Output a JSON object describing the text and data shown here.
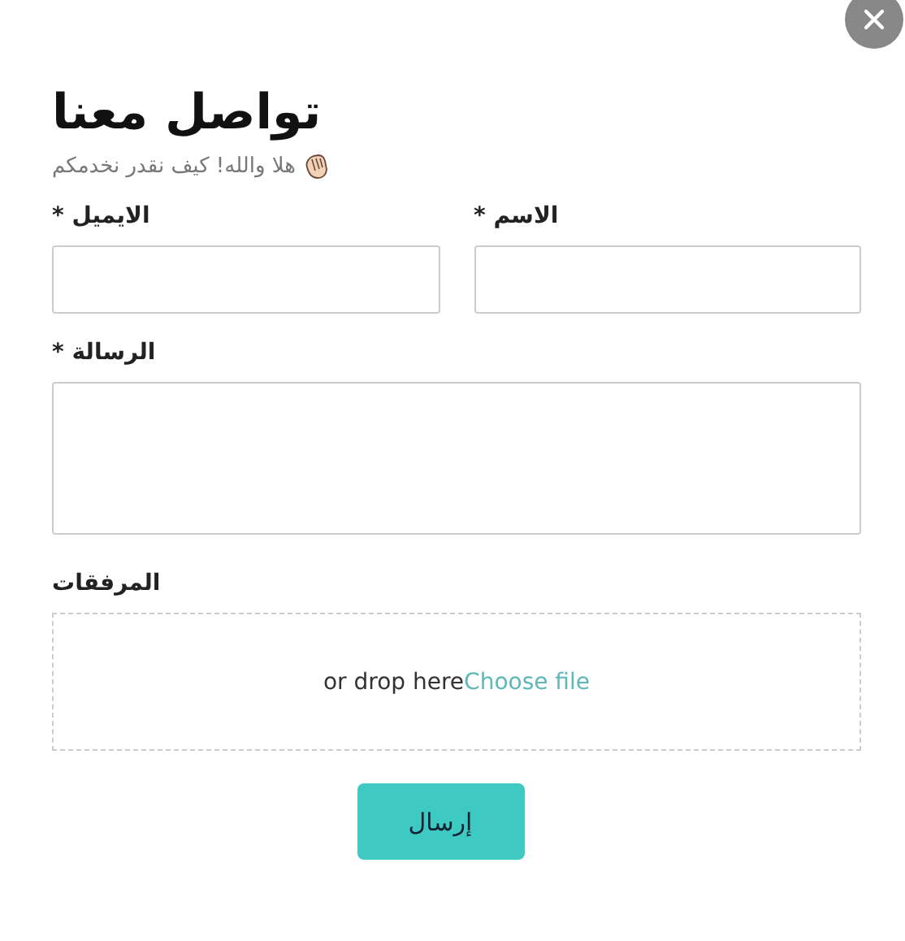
{
  "title": "تواصل معنا",
  "subtitle": "هلا والله! كيف نقدر نخدمكم",
  "fields": [
    {
      "kind": "text",
      "label": "الايميل *"
    },
    {
      "kind": "text",
      "label": "الاسم *"
    },
    {
      "kind": "textarea",
      "label": "الرسالة *"
    }
  ],
  "attachments": {
    "label": "المرفقات",
    "drop_text": "or drop here",
    "link": "Choose file"
  },
  "submit": {
    "label": "إرسال"
  }
}
